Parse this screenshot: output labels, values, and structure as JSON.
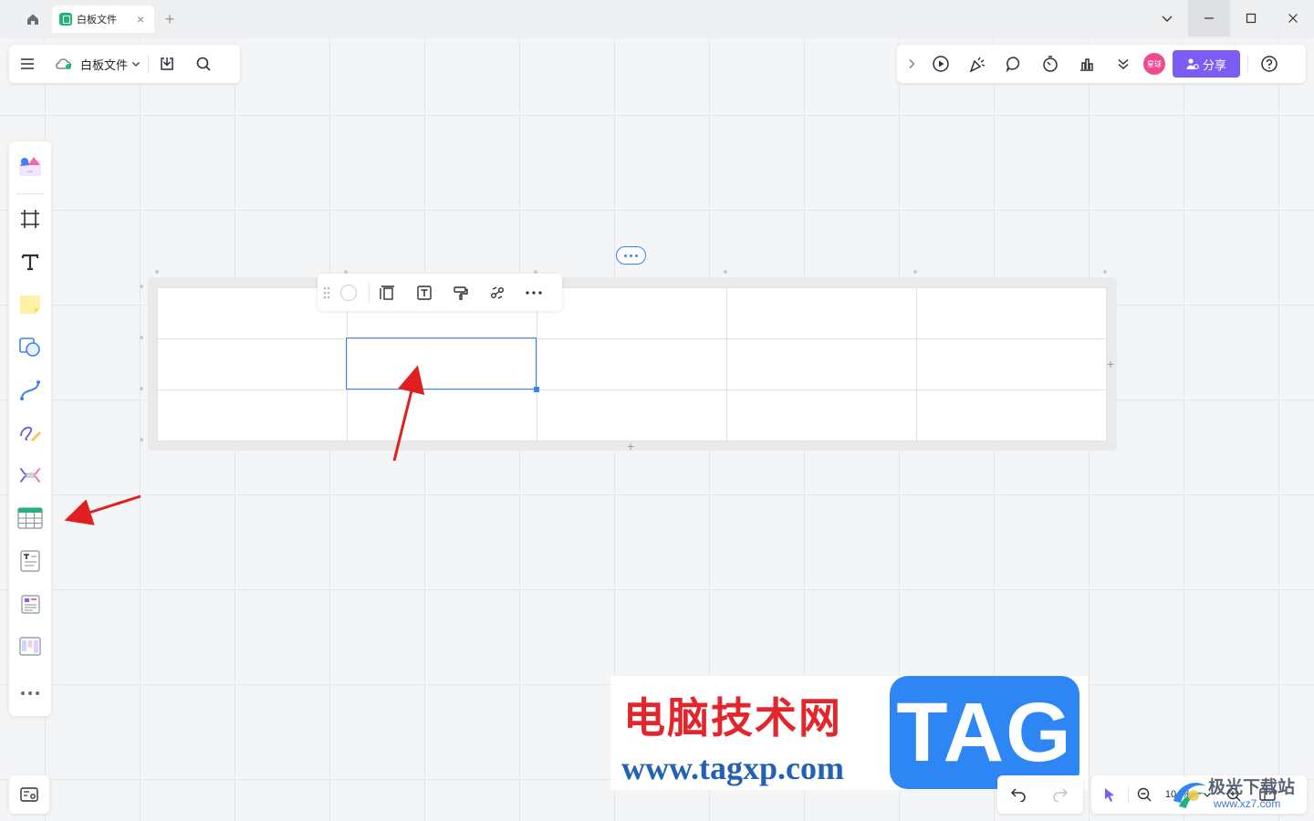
{
  "app": {
    "tab_title": "白板文件",
    "new_tab": "+",
    "tab_close": "×"
  },
  "toolbar_left": {
    "file_name": "白板文件"
  },
  "toolbar_right": {
    "avatar_text": "星球",
    "share_label": "分享",
    "accent_color": "#7b5cf5"
  },
  "left_tools": [
    {
      "name": "template-library",
      "icon": "template-icon"
    },
    {
      "name": "frame",
      "icon": "frame-icon"
    },
    {
      "name": "text",
      "icon": "text-icon"
    },
    {
      "name": "sticky-note",
      "icon": "sticky-note-icon"
    },
    {
      "name": "shape",
      "icon": "shape-icon"
    },
    {
      "name": "connector",
      "icon": "connector-icon"
    },
    {
      "name": "pen",
      "icon": "pen-icon"
    },
    {
      "name": "mindmap",
      "icon": "mindmap-icon"
    },
    {
      "name": "table",
      "icon": "table-icon"
    },
    {
      "name": "doc",
      "icon": "doc-icon"
    },
    {
      "name": "card",
      "icon": "card-icon"
    },
    {
      "name": "kanban",
      "icon": "kanban-icon"
    },
    {
      "name": "more",
      "icon": "more-icon"
    }
  ],
  "table": {
    "rows": 3,
    "cols": 5,
    "selected_cell": {
      "row": 2,
      "col": 2
    },
    "cells": [
      [
        "",
        "",
        "",
        "",
        ""
      ],
      [
        "",
        "",
        "",
        "",
        ""
      ],
      [
        "",
        "",
        "",
        "",
        ""
      ]
    ]
  },
  "zoom": {
    "value": "104%"
  },
  "watermark": {
    "title": "电脑技术网",
    "url": "www.tagxp.com",
    "tag": "TAG",
    "site_name": "极光下载站",
    "site_url": "www.xz7.com"
  }
}
